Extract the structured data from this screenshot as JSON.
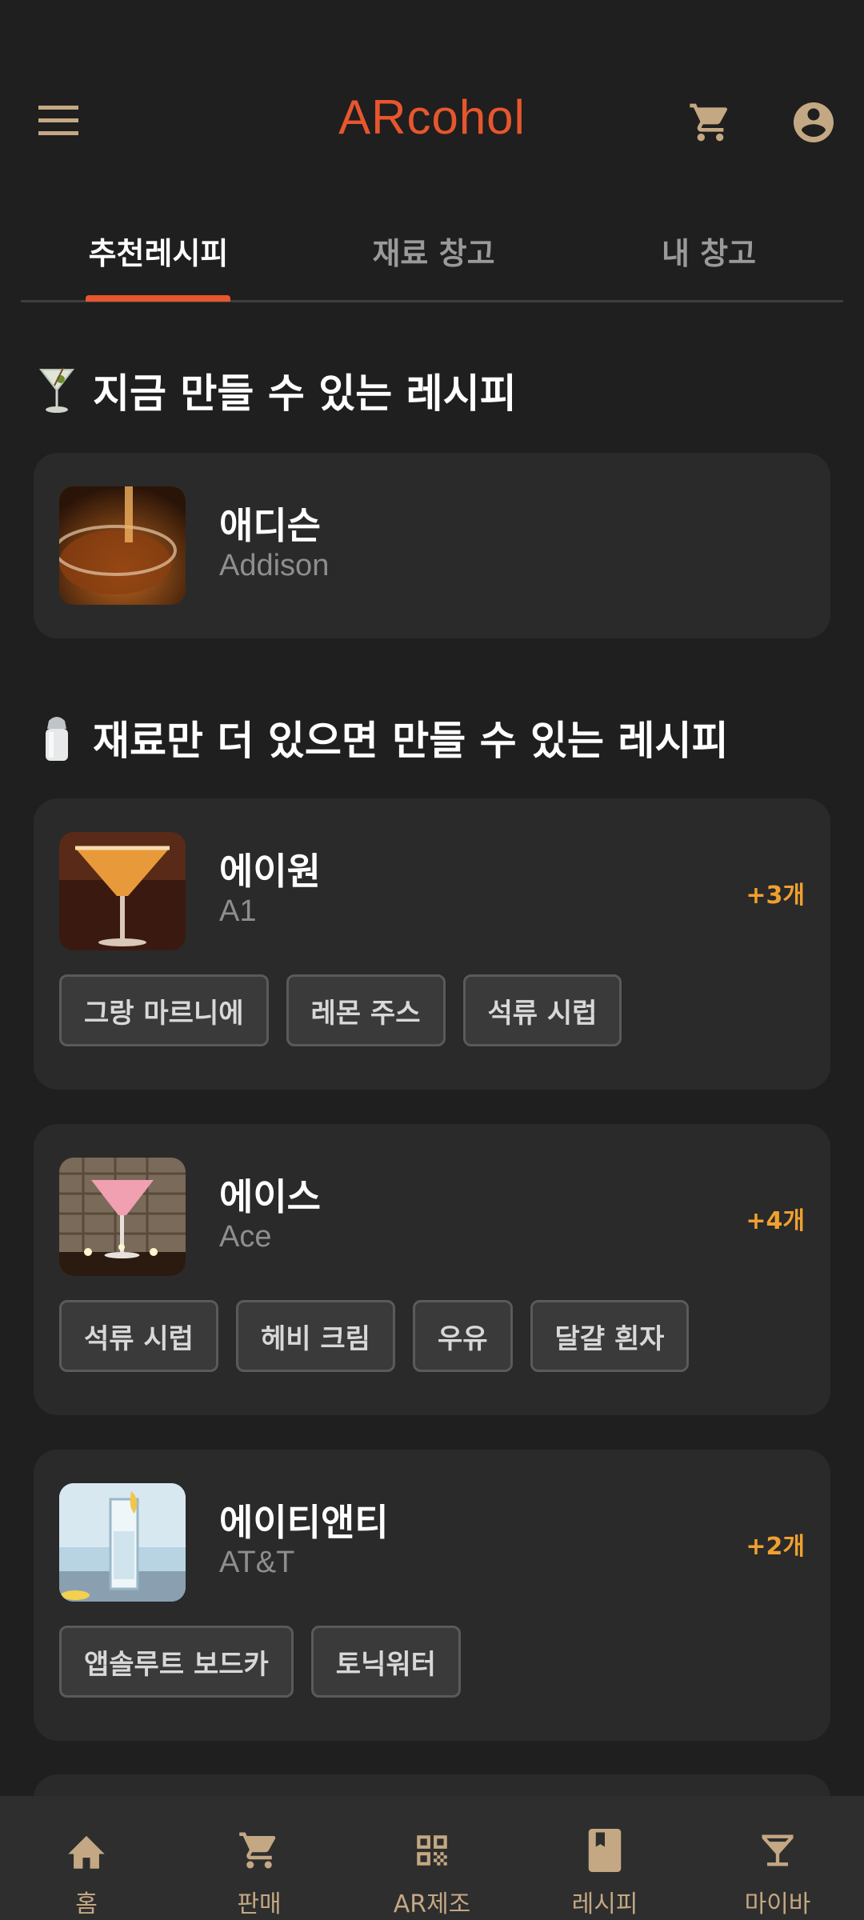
{
  "app": {
    "title": "ARcohol"
  },
  "colors": {
    "accent": "#e8562d",
    "background": "#1f1f1f",
    "card": "#2a2a2a",
    "icon": "#c4a883",
    "count": "#f0a030"
  },
  "tabs": [
    {
      "label": "추천레시피",
      "active": true
    },
    {
      "label": "재료 창고",
      "active": false
    },
    {
      "label": "내 창고",
      "active": false
    }
  ],
  "sections": {
    "available": {
      "emoji": "cocktail-glass-icon",
      "title": "지금 만들 수 있는 레시피"
    },
    "almost": {
      "emoji": "salt-shaker-icon",
      "title": "재료만 더 있으면 만들 수 있는 레시피"
    }
  },
  "available_recipes": [
    {
      "name_ko": "애디슨",
      "name_en": "Addison"
    }
  ],
  "almost_recipes": [
    {
      "name_ko": "에이원",
      "name_en": "A1",
      "missing": "+3개",
      "ingredients": [
        "그랑 마르니에",
        "레몬 주스",
        "석류 시럽"
      ]
    },
    {
      "name_ko": "에이스",
      "name_en": "Ace",
      "missing": "+4개",
      "ingredients": [
        "석류 시럽",
        "헤비 크림",
        "우유",
        "달걀 흰자"
      ]
    },
    {
      "name_ko": "에이티앤티",
      "name_en": "AT&T",
      "missing": "+2개",
      "ingredients": [
        "앱솔루트 보드카",
        "토닉워터"
      ]
    }
  ],
  "bottom_nav": [
    {
      "label": "홈",
      "icon": "home-icon"
    },
    {
      "label": "판매",
      "icon": "cart-icon"
    },
    {
      "label": "AR제조",
      "icon": "qr-code-icon"
    },
    {
      "label": "레시피",
      "icon": "book-icon"
    },
    {
      "label": "마이바",
      "icon": "cocktail-icon"
    }
  ]
}
